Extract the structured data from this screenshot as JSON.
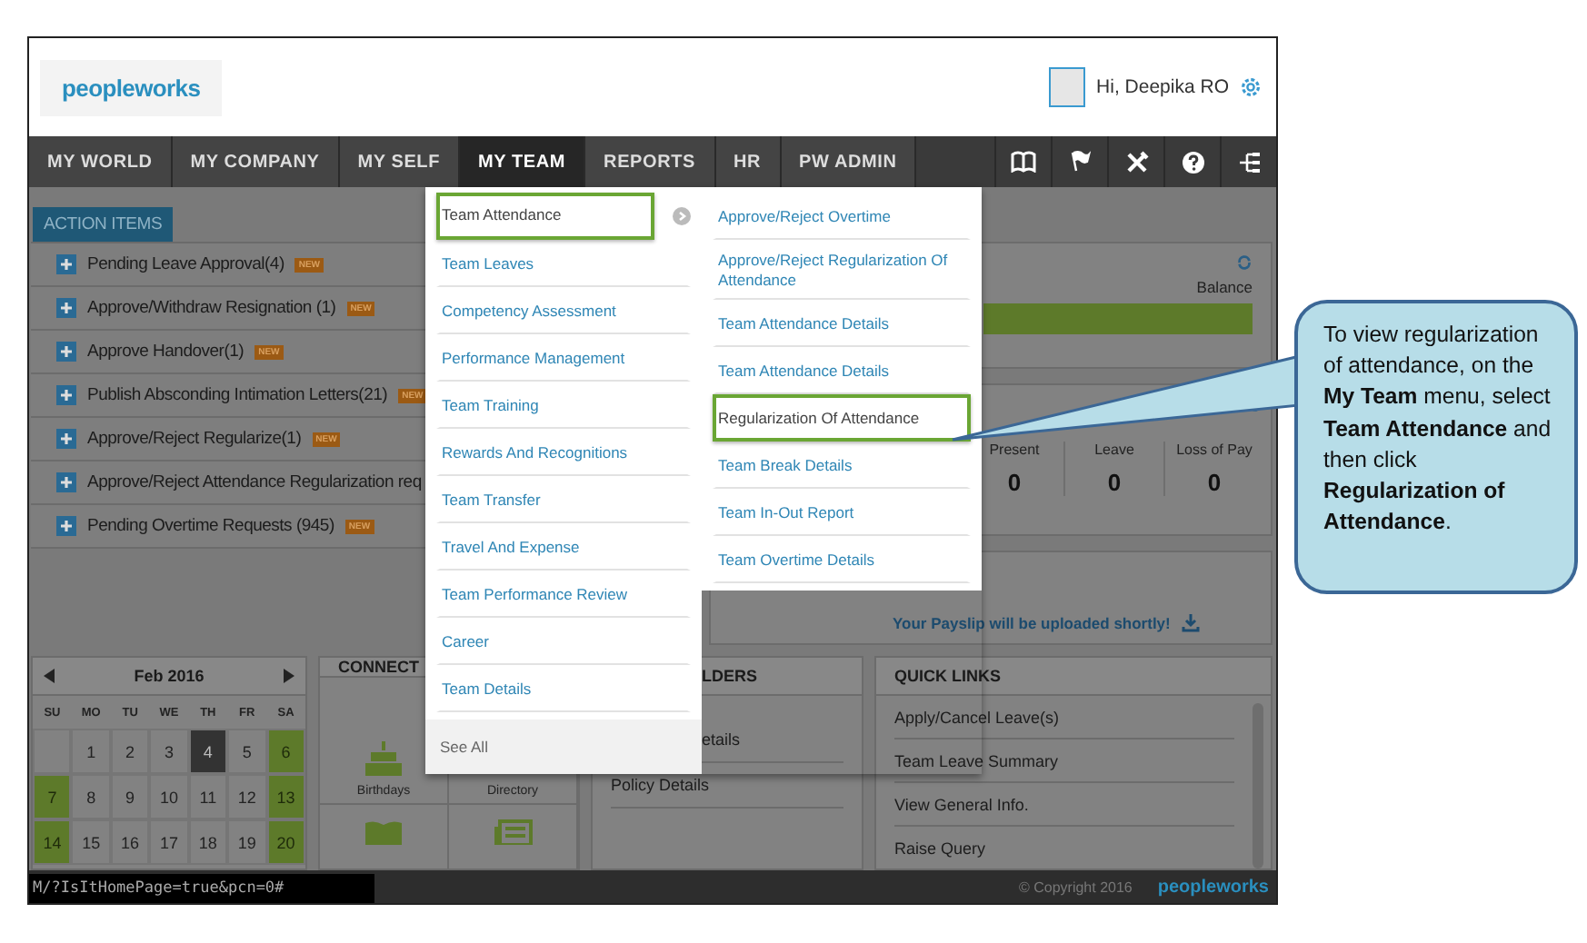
{
  "header": {
    "logo": "peopleworks",
    "greeting": "Hi, Deepika RO"
  },
  "nav": {
    "items": [
      {
        "label": "MY WORLD",
        "selected": false
      },
      {
        "label": "MY COMPANY",
        "selected": false
      },
      {
        "label": "MY SELF",
        "selected": false
      },
      {
        "label": "MY TEAM",
        "selected": true
      },
      {
        "label": "REPORTS",
        "selected": false
      },
      {
        "label": "HR",
        "selected": false
      },
      {
        "label": "PW ADMIN",
        "selected": false
      }
    ]
  },
  "action_items": {
    "tab": "ACTION ITEMS",
    "items": [
      {
        "label": "Pending Leave Approval(4)",
        "badge": "NEW"
      },
      {
        "label": "Approve/Withdraw Resignation (1)",
        "badge": "NEW"
      },
      {
        "label": "Approve Handover(1)",
        "badge": "NEW"
      },
      {
        "label": "Publish Absconding Intimation Letters(21)",
        "badge": "NEW"
      },
      {
        "label": "Approve/Reject Regularize(1)",
        "badge": "NEW"
      },
      {
        "label": "Approve/Reject Attendance Regularization req"
      },
      {
        "label": "Pending Overtime Requests (945)",
        "badge": "NEW"
      }
    ]
  },
  "leave_widget": {
    "balance_label": "Balance"
  },
  "attendance_widget": {
    "stats": [
      {
        "label": "Present",
        "value": "0"
      },
      {
        "label": "Leave",
        "value": "0"
      },
      {
        "label": "Loss of Pay",
        "value": "0"
      }
    ]
  },
  "payslip": {
    "message": "Your Payslip will be uploaded shortly!"
  },
  "calendar": {
    "month": "Feb 2016",
    "weekdays": [
      "SU",
      "MO",
      "TU",
      "WE",
      "TH",
      "FR",
      "SA"
    ],
    "days": [
      {
        "kind": "blank"
      },
      {
        "kind": "day",
        "label": "1"
      },
      {
        "kind": "day",
        "label": "2"
      },
      {
        "kind": "day",
        "label": "3"
      },
      {
        "kind": "today",
        "label": "4"
      },
      {
        "kind": "day",
        "label": "5"
      },
      {
        "kind": "weekend",
        "label": "6"
      },
      {
        "kind": "weekend",
        "label": "7"
      },
      {
        "kind": "day",
        "label": "8"
      },
      {
        "kind": "day",
        "label": "9"
      },
      {
        "kind": "day",
        "label": "10"
      },
      {
        "kind": "day",
        "label": "11"
      },
      {
        "kind": "day",
        "label": "12"
      },
      {
        "kind": "weekend",
        "label": "13"
      },
      {
        "kind": "weekend",
        "label": "14"
      },
      {
        "kind": "day",
        "label": "15"
      },
      {
        "kind": "day",
        "label": "16"
      },
      {
        "kind": "day",
        "label": "17"
      },
      {
        "kind": "day",
        "label": "18"
      },
      {
        "kind": "day",
        "label": "19"
      },
      {
        "kind": "weekend",
        "label": "20"
      }
    ]
  },
  "connect": {
    "title": "CONNECT",
    "tiles": [
      {
        "kind": "cake",
        "label": "Birthdays"
      },
      {
        "kind": "hidden",
        "label": "Directory"
      },
      {
        "kind": "book"
      },
      {
        "kind": "news"
      }
    ]
  },
  "holders": {
    "title": "LDERS",
    "items": [
      {
        "label": "etails",
        "kind": "cut"
      },
      {
        "label": "Policy Details",
        "kind": "full"
      }
    ]
  },
  "quick_links": {
    "title": "QUICK LINKS",
    "items": [
      "Apply/Cancel Leave(s)",
      "Team Leave Summary",
      "View General Info.",
      "Raise Query"
    ]
  },
  "menu": {
    "left": [
      {
        "label": "Team Attendance",
        "selected": true
      },
      {
        "label": "Team Leaves",
        "selected": false
      },
      {
        "label": "Competency Assessment",
        "selected": false
      },
      {
        "label": "Performance Management",
        "selected": false
      },
      {
        "label": "Team Training",
        "selected": false
      },
      {
        "label": "Rewards And Recognitions",
        "selected": false
      },
      {
        "label": "Team Transfer",
        "selected": false
      },
      {
        "label": "Travel And Expense",
        "selected": false
      },
      {
        "label": "Team Performance Review",
        "selected": false
      },
      {
        "label": "Career",
        "selected": false
      },
      {
        "label": "Team Details",
        "selected": false
      }
    ],
    "see_all": "See All",
    "right": [
      {
        "label": "Approve/Reject Overtime",
        "selected": false
      },
      {
        "label": "Approve/Reject Regularization Of Attendance",
        "selected": false
      },
      {
        "label": "Team Attendance Details",
        "selected": false
      },
      {
        "label": "Team Attendance Details",
        "selected": false
      },
      {
        "label": "Regularization Of Attendance",
        "selected": true
      },
      {
        "label": "Team Break Details",
        "selected": false
      },
      {
        "label": "Team In-Out Report",
        "selected": false
      },
      {
        "label": "Team Overtime Details",
        "selected": false
      }
    ]
  },
  "callout": {
    "text": "To view regularization of attendance, on the **My Team** menu, select **Team Attendance** and then click **Regularization of Attendance**."
  },
  "status_bar": {
    "url": "M/?IsItHomePage=true&pcn=0#",
    "copyright": "© Copyright 2016",
    "logo": "peopleworks"
  }
}
